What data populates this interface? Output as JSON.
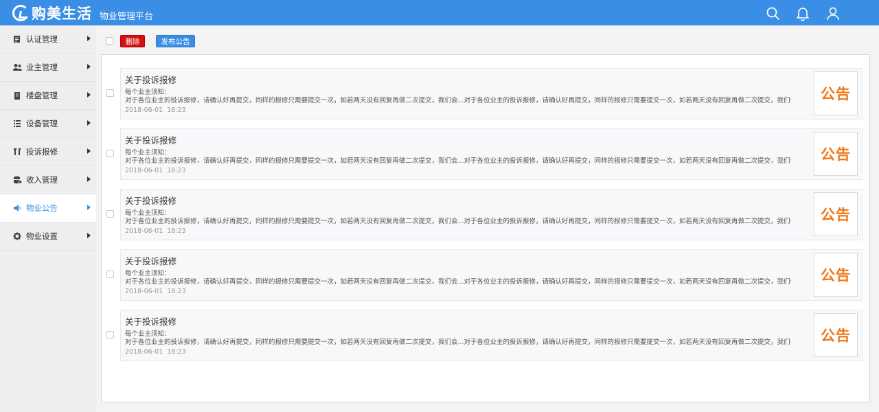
{
  "header": {
    "brand": "购美生活",
    "platform": "物业管理平台",
    "icons": [
      "search-icon",
      "bell-icon",
      "user-icon"
    ]
  },
  "sidebar": {
    "items": [
      {
        "label": "认证管理",
        "icon": "certificate-icon"
      },
      {
        "label": "业主管理",
        "icon": "people-icon"
      },
      {
        "label": "楼盘管理",
        "icon": "building-icon"
      },
      {
        "label": "设备管理",
        "icon": "list-icon"
      },
      {
        "label": "投诉报修",
        "icon": "tools-icon"
      },
      {
        "label": "收入管理",
        "icon": "database-icon"
      },
      {
        "label": "物业公告",
        "icon": "speaker-icon",
        "active": true
      },
      {
        "label": "物业设置",
        "icon": "gear-icon"
      }
    ]
  },
  "toolbar": {
    "delete_label": "删除",
    "publish_label": "发布公告"
  },
  "notices": [
    {
      "title": "关于投诉报修",
      "subtitle": "每个业主须知：",
      "body": "对于各位业主的投诉报修，请确认好再提交，同样的报修只需要提交一次，如若两天没有回复再做二次提交，我们会...对于各位业主的投诉报修，请确认好再提交，同样的报修只需要提交一次，如若两天没有回复再做二次提交，我们会...",
      "date": "2018-06-01",
      "time": "18:23",
      "thumb": "公告"
    },
    {
      "title": "关于投诉报修",
      "subtitle": "每个业主须知：",
      "body": "对于各位业主的投诉报修，请确认好再提交，同样的报修只需要提交一次，如若两天没有回复再做二次提交，我们会...对于各位业主的投诉报修，请确认好再提交，同样的报修只需要提交一次，如若两天没有回复再做二次提交，我们会...",
      "date": "2018-06-01",
      "time": "18:23",
      "thumb": "公告"
    },
    {
      "title": "关于投诉报修",
      "subtitle": "每个业主须知：",
      "body": "对于各位业主的投诉报修，请确认好再提交，同样的报修只需要提交一次，如若两天没有回复再做二次提交，我们会...对于各位业主的投诉报修，请确认好再提交，同样的报修只需要提交一次，如若两天没有回复再做二次提交，我们会...",
      "date": "2018-06-01",
      "time": "18:23",
      "thumb": "公告"
    },
    {
      "title": "关于投诉报修",
      "subtitle": "每个业主须知：",
      "body": "对于各位业主的投诉报修，请确认好再提交，同样的报修只需要提交一次，如若两天没有回复再做二次提交，我们会...对于各位业主的投诉报修，请确认好再提交，同样的报修只需要提交一次，如若两天没有回复再做二次提交，我们会...",
      "date": "2018-06-01",
      "time": "18:23",
      "thumb": "公告"
    },
    {
      "title": "关于投诉报修",
      "subtitle": "每个业主须知：",
      "body": "对于各位业主的投诉报修，请确认好再提交，同样的报修只需要提交一次，如若两天没有回复再做二次提交，我们会...对于各位业主的投诉报修，请确认好再提交，同样的报修只需要提交一次，如若两天没有回复再做二次提交，我们会...",
      "date": "2018-06-01",
      "time": "18:23",
      "thumb": "公告"
    }
  ],
  "colors": {
    "header": "#3a8ee6",
    "delete": "#d41111",
    "accent": "#3a8ee6",
    "thumb_text": "#f07818"
  }
}
